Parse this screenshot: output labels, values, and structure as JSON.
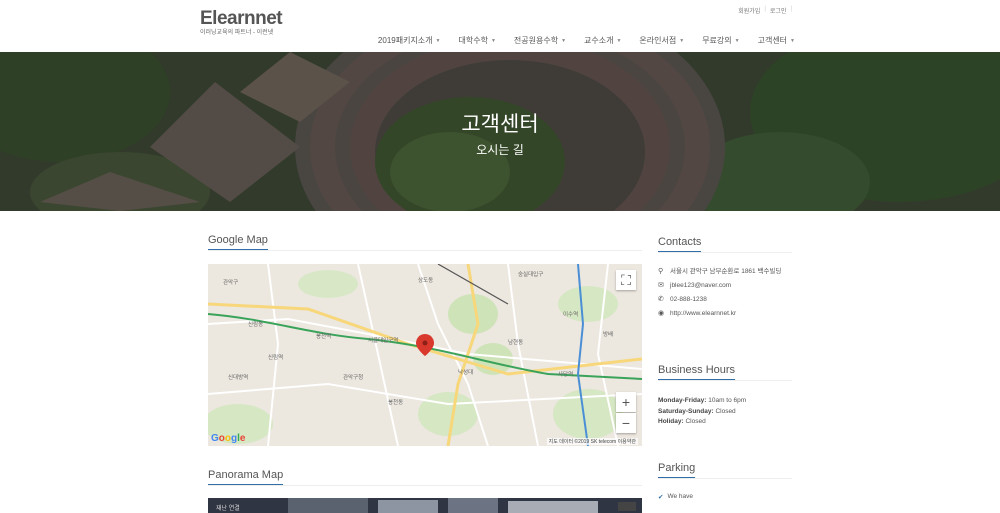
{
  "header": {
    "logo": "Elearnnet",
    "logo_sub": "이러닝교육의 파트너 - 이런넷",
    "util_links": [
      "회원가입",
      "로그인"
    ],
    "nav": [
      "2019패키지소개",
      "대학수학",
      "전공원용수학",
      "교수소개",
      "온라인서점",
      "무료강의",
      "고객센터"
    ]
  },
  "hero": {
    "title": "고객센터",
    "subtitle": "오시는 길"
  },
  "main": {
    "google_map_title": "Google Map",
    "panorama_title": "Panorama Map",
    "map": {
      "fullscreen_icon": "fullscreen-icon",
      "zoom_in": "+",
      "zoom_out": "−",
      "google_logo": "Google",
      "credit": "지도 데이터 ©2019 SK telecom   이용약관",
      "labels": [
        "도림천",
        "신림동",
        "서울대입구역",
        "봉천역",
        "낙성대",
        "관악구청",
        "신대방역",
        "사당역",
        "이수역",
        "방배",
        "신림역",
        "상도동",
        "숭실대입구",
        "봉천동",
        "남현동"
      ]
    },
    "pano_label": "재난 연결"
  },
  "sidebar": {
    "contacts_title": "Contacts",
    "contacts": [
      {
        "icon": "map-marker-icon",
        "text": "서울시 관악구 남부순환로 1861 백수빌딩"
      },
      {
        "icon": "envelope-icon",
        "text": "jblee123@naver.com"
      },
      {
        "icon": "phone-icon",
        "text": "02-888-1238"
      },
      {
        "icon": "globe-icon",
        "text": "http://www.elearnnet.kr"
      }
    ],
    "hours_title": "Business Hours",
    "hours": [
      {
        "label": "Monday-Friday:",
        "value": "10am to 6pm"
      },
      {
        "label": "Saturday-Sunday:",
        "value": "Closed"
      },
      {
        "label": "Holiday:",
        "value": "Closed"
      }
    ],
    "parking_title": "Parking",
    "parking_text": "We have"
  },
  "colors": {
    "accent": "#2f6ea8",
    "map_marker": "#d9382d",
    "subway_green": "#3aa35a"
  }
}
